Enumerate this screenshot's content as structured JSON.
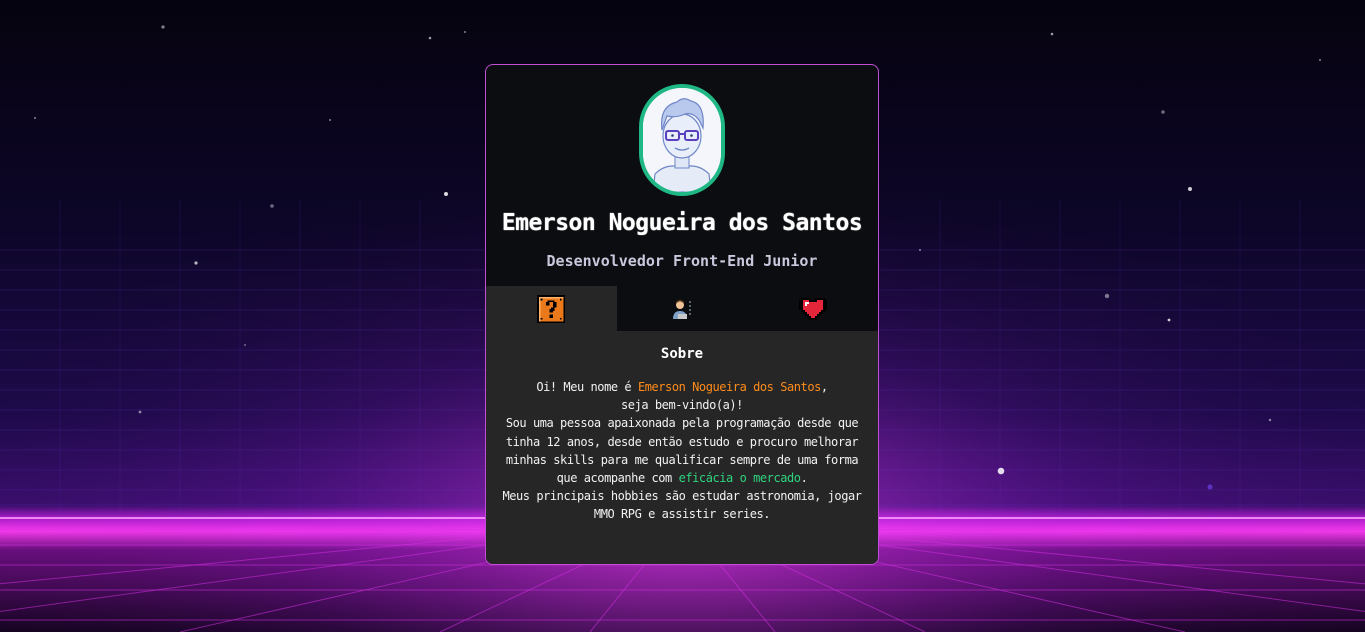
{
  "profile": {
    "name": "Emerson Nogueira dos Santos",
    "role": "Desenvolvedor Front-End Junior"
  },
  "tabs": [
    {
      "name": "tab-sobre",
      "icon": "question-block-icon",
      "active": true
    },
    {
      "name": "tab-skills",
      "icon": "developer-icon",
      "active": false
    },
    {
      "name": "tab-hobbies",
      "icon": "heart-icon",
      "active": false
    }
  ],
  "about": {
    "title": "Sobre",
    "greeting_prefix": "Oi! Meu nome é ",
    "greeting_name": "Emerson Nogueira dos Santos",
    "greeting_suffix": ",",
    "welcome": "seja bem-vindo(a)!",
    "text_1": "Sou uma pessoa apaixonada pela programação desde que tinha 12 anos, desde então estudo e procuro melhorar minhas skills para me qualificar sempre de uma forma que acompanhe com ",
    "text_highlight": "eficácia o mercado",
    "text_2": ".",
    "text_3": "Meus principais hobbies são estudar astronomia, jogar MMO RPG e assistir series."
  },
  "colors": {
    "accent_orange": "#ff8c1a",
    "accent_green": "#2fd47f",
    "card_border": "#c04fd6",
    "avatar_ring": "#1fb885"
  }
}
